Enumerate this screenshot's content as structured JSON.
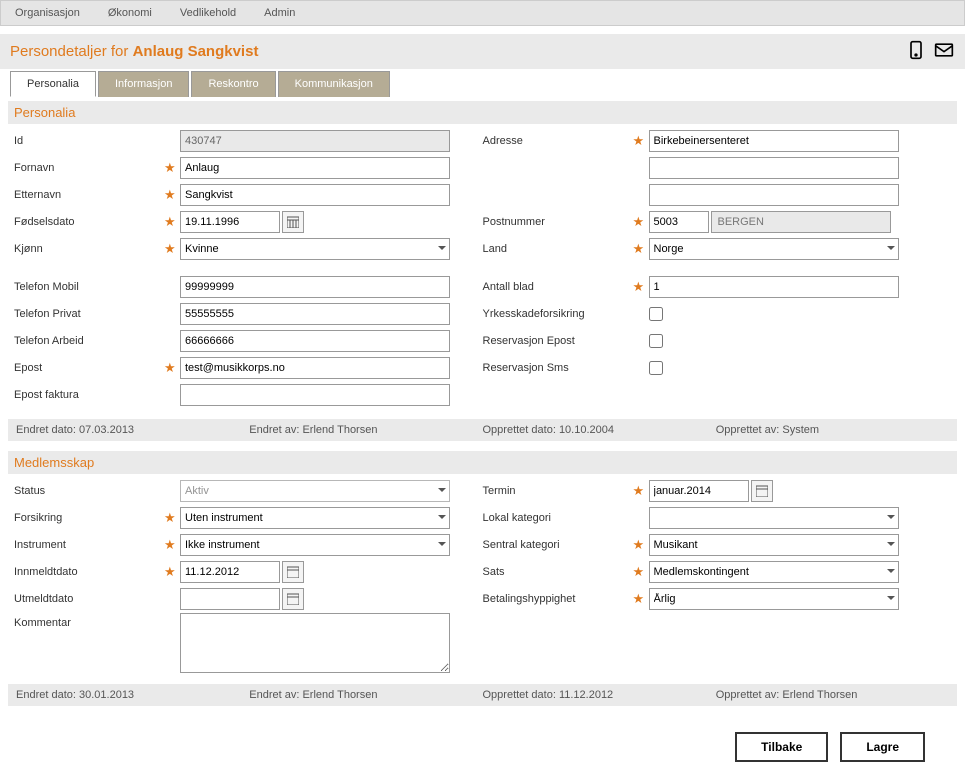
{
  "menu": {
    "items": [
      "Organisasjon",
      "Økonomi",
      "Vedlikehold",
      "Admin"
    ]
  },
  "header": {
    "prefix": "Persondetaljer for ",
    "name": "Anlaug Sangkvist"
  },
  "tabs": [
    "Personalia",
    "Informasjon",
    "Reskontro",
    "Kommunikasjon"
  ],
  "personalia": {
    "title": "Personalia",
    "labels": {
      "id": "Id",
      "fornavn": "Fornavn",
      "etternavn": "Etternavn",
      "fodselsdato": "Fødselsdato",
      "kjonn": "Kjønn",
      "telMobil": "Telefon Mobil",
      "telPrivat": "Telefon Privat",
      "telArbeid": "Telefon Arbeid",
      "epost": "Epost",
      "epostFaktura": "Epost faktura",
      "adresse": "Adresse",
      "postnummer": "Postnummer",
      "land": "Land",
      "antallBlad": "Antall blad",
      "yrkesskade": "Yrkesskadeforsikring",
      "resEpost": "Reservasjon Epost",
      "resSms": "Reservasjon Sms"
    },
    "values": {
      "id": "430747",
      "fornavn": "Anlaug",
      "etternavn": "Sangkvist",
      "fodselsdato": "19.11.1996",
      "kjonn": "Kvinne",
      "telMobil": "99999999",
      "telPrivat": "55555555",
      "telArbeid": "66666666",
      "epost": "test@musikkorps.no",
      "epostFaktura": "",
      "adresse": "Birkebeinersenteret",
      "adresse2": "",
      "adresse3": "",
      "postnummer": "5003",
      "postby": "BERGEN",
      "land": "Norge",
      "antallBlad": "1"
    },
    "meta": {
      "endretDatoLbl": "Endret dato: ",
      "endretDato": "07.03.2013",
      "endretAvLbl": "Endret av: ",
      "endretAv": "Erlend Thorsen",
      "opprettetDatoLbl": "Opprettet dato: ",
      "opprettetDato": "10.10.2004",
      "opprettetAvLbl": "Opprettet av: ",
      "opprettetAv": "System"
    }
  },
  "medlemsskap": {
    "title": "Medlemsskap",
    "labels": {
      "status": "Status",
      "forsikring": "Forsikring",
      "instrument": "Instrument",
      "innmeldt": "Innmeldtdato",
      "utmeldt": "Utmeldtdato",
      "kommentar": "Kommentar",
      "termin": "Termin",
      "lokalKat": "Lokal kategori",
      "sentralKat": "Sentral kategori",
      "sats": "Sats",
      "betaling": "Betalingshyppighet"
    },
    "values": {
      "status": "Aktiv",
      "forsikring": "Uten instrument",
      "instrument": "Ikke instrument",
      "innmeldt": "11.12.2012",
      "utmeldt": "",
      "kommentar": "",
      "termin": "januar.2014",
      "lokalKat": "",
      "sentralKat": "Musikant",
      "sats": "Medlemskontingent",
      "betaling": "Årlig"
    },
    "meta": {
      "endretDatoLbl": "Endret dato: ",
      "endretDato": "30.01.2013",
      "endretAvLbl": "Endret av: ",
      "endretAv": "Erlend Thorsen",
      "opprettetDatoLbl": "Opprettet dato: ",
      "opprettetDato": "11.12.2012",
      "opprettetAvLbl": "Opprettet av: ",
      "opprettetAv": "Erlend Thorsen"
    }
  },
  "actions": {
    "back": "Tilbake",
    "save": "Lagre"
  }
}
